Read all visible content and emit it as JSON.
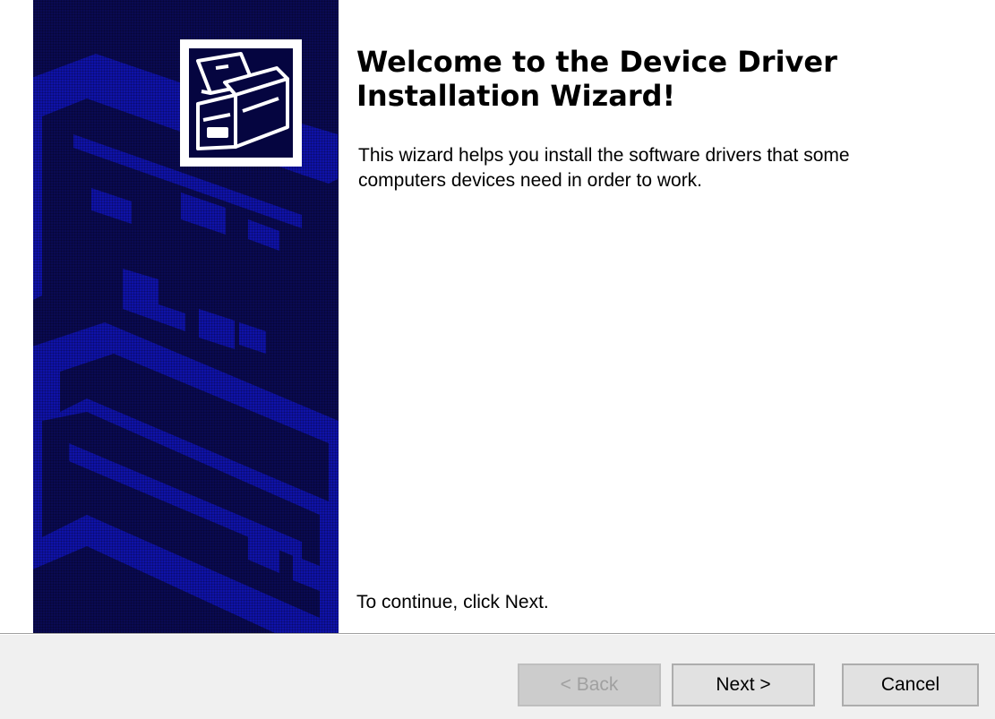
{
  "wizard": {
    "title": "Welcome to the Device Driver Installation Wizard!",
    "description": "This wizard helps you install the software drivers that some computers devices need in order to work.",
    "continue_text": "To continue, click Next."
  },
  "banner": {
    "logo_icon": "computer-drive-icon",
    "background_color": "#0a0a52",
    "art_color": "#0f12a8"
  },
  "buttons": {
    "back_label": "< Back",
    "back_enabled": false,
    "next_label": "Next >",
    "cancel_label": "Cancel"
  }
}
